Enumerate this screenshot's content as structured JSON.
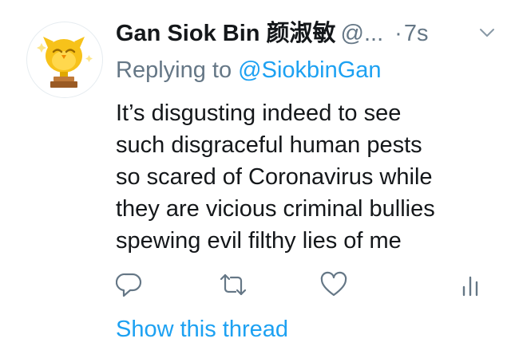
{
  "tweet": {
    "avatar_icon": "owl-trophy-avatar",
    "author_name": "Gan Siok Bin 颜淑敏",
    "handle": "@...",
    "separator": "·",
    "time": "7s",
    "replying_prefix": "Replying to ",
    "replying_to": "@SiokbinGan",
    "text_lines": [
      "It’s disgusting indeed to see",
      "such disgraceful human pests",
      "so scared of Coronavirus while",
      "they are vicious criminal bullies",
      "spewing evil filthy lies of me"
    ],
    "show_thread": "Show this thread"
  },
  "icons": {
    "reply": "reply-icon",
    "retweet": "retweet-icon",
    "like": "like-icon",
    "analytics": "analytics-icon",
    "caret": "chevron-down-icon"
  },
  "colors": {
    "text": "#14171a",
    "secondary": "#657786",
    "link": "#1da1f2",
    "avatar_yellow": "#f7c21a"
  }
}
